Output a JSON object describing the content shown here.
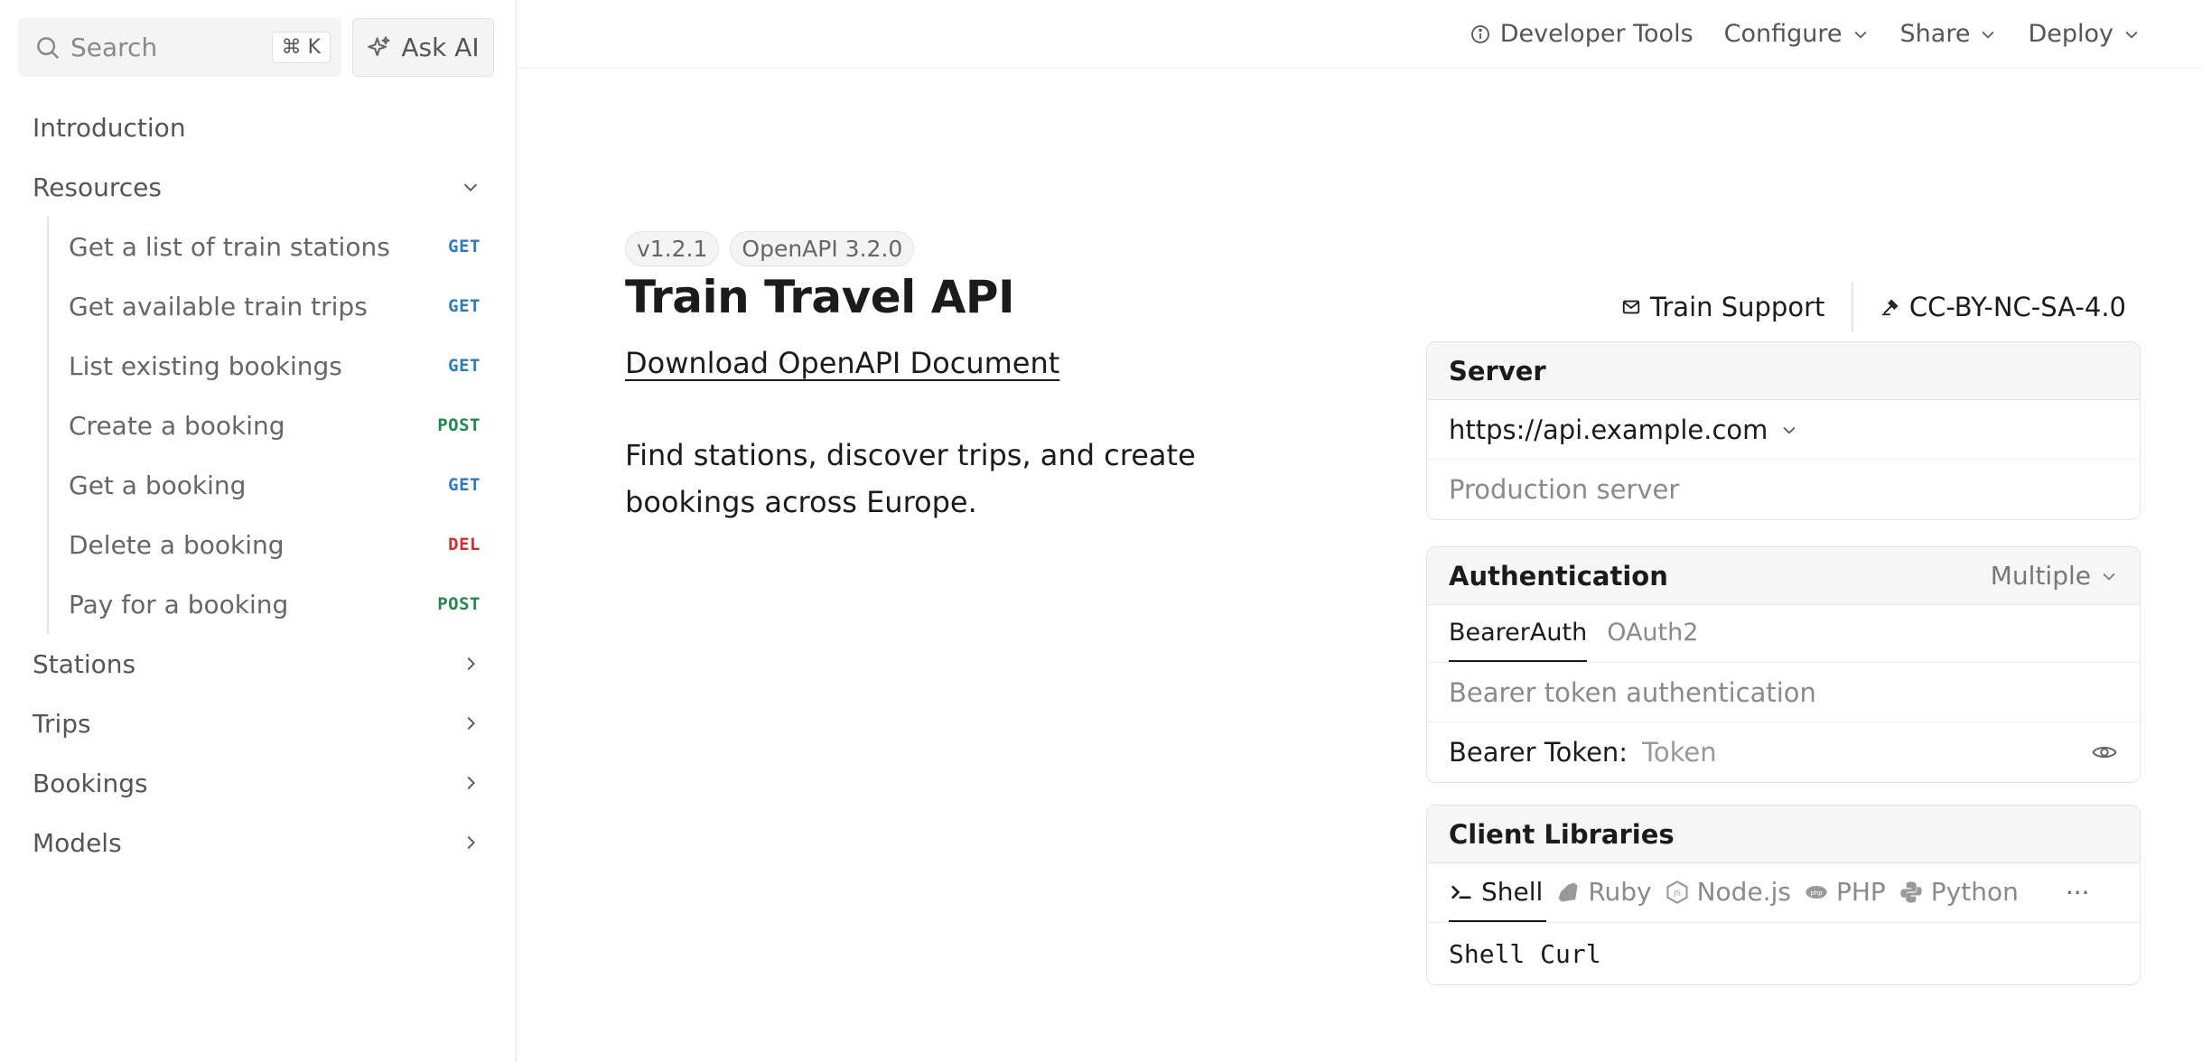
{
  "colors": {
    "get": "#2b7bbd",
    "post": "#1f8a4c",
    "del": "#d1302f"
  },
  "sidebar": {
    "search_placeholder": "Search",
    "search_shortcut": "⌘ K",
    "ask_ai": "Ask AI",
    "items": [
      {
        "label": "Introduction"
      },
      {
        "label": "Resources",
        "expanded": true,
        "children": [
          {
            "label": "Get a list of train stations",
            "method": "GET"
          },
          {
            "label": "Get available train trips",
            "method": "GET"
          },
          {
            "label": "List existing bookings",
            "method": "GET"
          },
          {
            "label": "Create a booking",
            "method": "POST"
          },
          {
            "label": "Get a booking",
            "method": "GET"
          },
          {
            "label": "Delete a booking",
            "method": "DEL"
          },
          {
            "label": "Pay for a booking",
            "method": "POST"
          }
        ]
      },
      {
        "label": "Stations"
      },
      {
        "label": "Trips"
      },
      {
        "label": "Bookings"
      },
      {
        "label": "Models"
      }
    ]
  },
  "topbar": {
    "developer_tools": "Developer Tools",
    "configure": "Configure",
    "share": "Share",
    "deploy": "Deploy"
  },
  "main": {
    "version_badge": "v1.2.1",
    "openapi_badge": "OpenAPI 3.2.0",
    "title": "Train Travel API",
    "download_link": "Download OpenAPI Document",
    "description": "Find stations, discover trips, and create bookings across Europe.",
    "contact": "Train Support",
    "license": "CC-BY-NC-SA-4.0"
  },
  "server": {
    "heading": "Server",
    "url": "https://api.example.com",
    "description": "Production server"
  },
  "auth": {
    "heading": "Authentication",
    "mode": "Multiple",
    "tabs": [
      "BearerAuth",
      "OAuth2"
    ],
    "description": "Bearer token authentication",
    "token_label": "Bearer Token:",
    "token_placeholder": "Token"
  },
  "client_libraries": {
    "heading": "Client Libraries",
    "tabs": [
      "Shell",
      "Ruby",
      "Node.js",
      "PHP",
      "Python"
    ],
    "more": "···",
    "selected_client": "Shell Curl"
  }
}
